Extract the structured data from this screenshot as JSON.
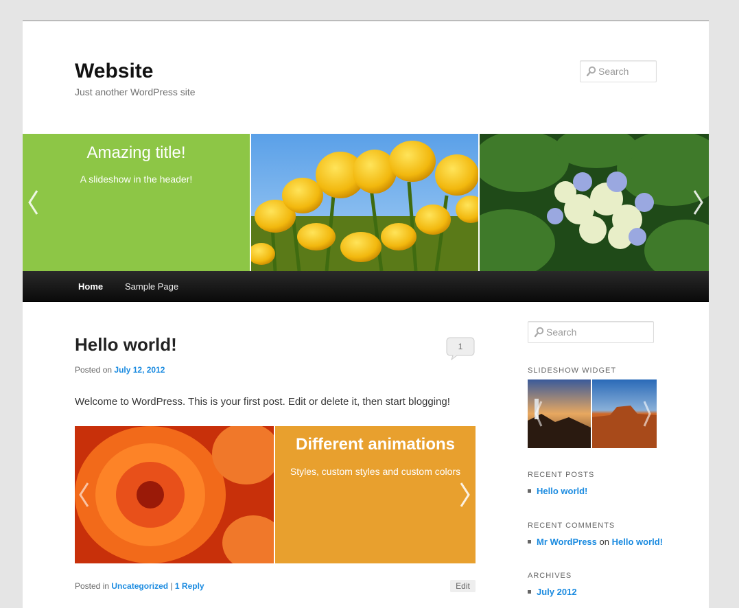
{
  "header": {
    "site_title": "Website",
    "site_description": "Just another WordPress site",
    "search_placeholder": "Search"
  },
  "header_slideshow": {
    "slide_title": "Amazing title!",
    "slide_text": "A slideshow in the header!",
    "prev_icon": "chevron-left-icon",
    "next_icon": "chevron-right-icon"
  },
  "nav": {
    "items": [
      {
        "label": "Home"
      },
      {
        "label": "Sample Page"
      }
    ]
  },
  "post": {
    "title": "Hello world!",
    "comment_count": "1",
    "posted_on_label": "Posted on",
    "date": "July 12, 2012",
    "body": "Welcome to WordPress. This is your first post. Edit or delete it, then start blogging!",
    "slide_title": "Different animations",
    "slide_text": "Styles, custom styles and custom colors",
    "posted_in_label": "Posted in",
    "category": "Uncategorized",
    "separator": "|",
    "reply_link": "1 Reply",
    "edit_label": "Edit"
  },
  "sidebar": {
    "search_placeholder": "Search",
    "slideshow_widget_title": "SLIDESHOW WIDGET",
    "recent_posts_title": "RECENT POSTS",
    "recent_posts": [
      {
        "label": "Hello world!"
      }
    ],
    "recent_comments_title": "RECENT COMMENTS",
    "recent_comment": {
      "author": "Mr WordPress",
      "on": "on",
      "post": "Hello world!"
    },
    "archives_title": "ARCHIVES",
    "archives": [
      {
        "label": "July 2012"
      }
    ]
  },
  "colors": {
    "green_slide": "#8dc646",
    "orange_slide": "#e8a02e",
    "link": "#1b8be0",
    "nav_bg": "#111111"
  }
}
